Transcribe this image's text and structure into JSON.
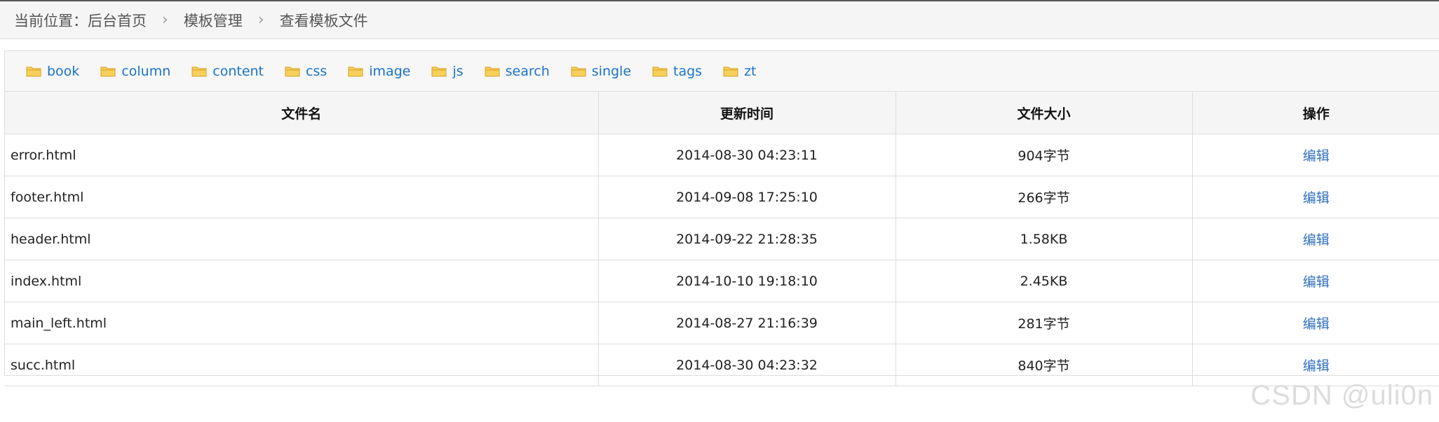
{
  "breadcrumb": {
    "label": "当前位置：",
    "items": [
      "后台首页",
      "模板管理",
      "查看模板文件"
    ],
    "separator": "›"
  },
  "folders": [
    {
      "name": "book"
    },
    {
      "name": "column"
    },
    {
      "name": "content"
    },
    {
      "name": "css"
    },
    {
      "name": "image"
    },
    {
      "name": "js"
    },
    {
      "name": "search"
    },
    {
      "name": "single"
    },
    {
      "name": "tags"
    },
    {
      "name": "zt"
    }
  ],
  "table": {
    "headers": [
      "文件名",
      "更新时间",
      "文件大小",
      "操作"
    ],
    "rows": [
      {
        "name": "error.html",
        "time": "2014-08-30 04:23:11",
        "size": "904字节",
        "action": "编辑"
      },
      {
        "name": "footer.html",
        "time": "2014-09-08 17:25:10",
        "size": "266字节",
        "action": "编辑"
      },
      {
        "name": "header.html",
        "time": "2014-09-22 21:28:35",
        "size": "1.58KB",
        "action": "编辑"
      },
      {
        "name": "index.html",
        "time": "2014-10-10 19:18:10",
        "size": "2.45KB",
        "action": "编辑"
      },
      {
        "name": "main_left.html",
        "time": "2014-08-27 21:16:39",
        "size": "281字节",
        "action": "编辑"
      },
      {
        "name": "succ.html",
        "time": "2014-08-30 04:23:32",
        "size": "840字节",
        "action": "编辑"
      }
    ]
  },
  "watermark": "CSDN @uli0n",
  "colors": {
    "link": "#1a73c8",
    "edit_link": "#2f6fc0",
    "folder_fill": "#f7cf5c",
    "folder_stroke": "#d9a21f",
    "header_bg": "#f5f5f5",
    "border": "#dcdcdc"
  },
  "icons": {
    "folder": "folder-icon",
    "separator": "chevron-right-icon"
  }
}
